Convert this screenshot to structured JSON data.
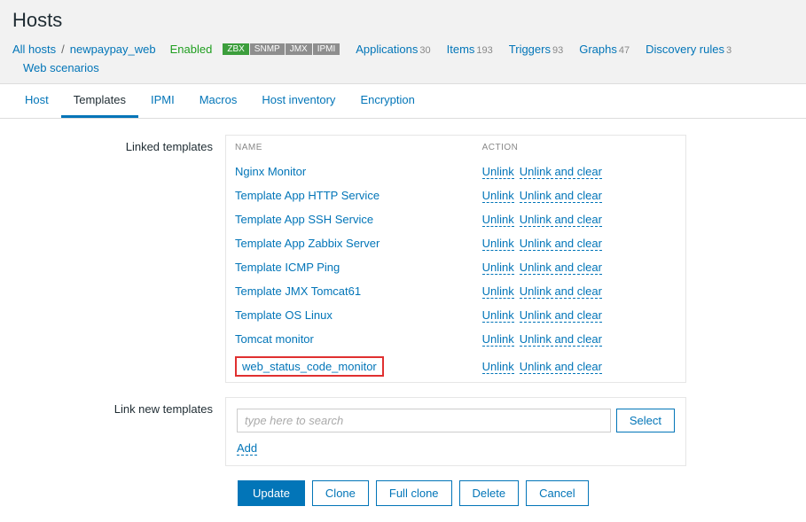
{
  "pageTitle": "Hosts",
  "breadcrumb": {
    "allHosts": "All hosts",
    "sep": "/",
    "hostName": "newpaypay_web",
    "enabled": "Enabled"
  },
  "proto": {
    "zbx": "ZBX",
    "snmp": "SNMP",
    "jmx": "JMX",
    "ipmi": "IPMI"
  },
  "stats": {
    "applications": {
      "label": "Applications",
      "count": "30"
    },
    "items": {
      "label": "Items",
      "count": "193"
    },
    "triggers": {
      "label": "Triggers",
      "count": "93"
    },
    "graphs": {
      "label": "Graphs",
      "count": "47"
    },
    "discovery": {
      "label": "Discovery rules",
      "count": "3"
    },
    "web": {
      "label": "Web scenarios"
    }
  },
  "tabs": {
    "host": "Host",
    "templates": "Templates",
    "ipmi": "IPMI",
    "macros": "Macros",
    "inventory": "Host inventory",
    "encryption": "Encryption"
  },
  "form": {
    "linkedLabel": "Linked templates",
    "linkNewLabel": "Link new templates",
    "headers": {
      "name": "NAME",
      "action": "ACTION"
    },
    "actions": {
      "unlink": "Unlink",
      "unlinkClear": "Unlink and clear"
    },
    "templates": {
      "t0": "Nginx Monitor",
      "t1": "Template App HTTP Service",
      "t2": "Template App SSH Service",
      "t3": "Template App Zabbix Server",
      "t4": "Template ICMP Ping",
      "t5": "Template JMX Tomcat61",
      "t6": "Template OS Linux",
      "t7": "Tomcat monitor",
      "t8": "web_status_code_monitor"
    },
    "search": {
      "placeholder": "type here to search",
      "selectBtn": "Select",
      "addLink": "Add"
    }
  },
  "buttons": {
    "update": "Update",
    "clone": "Clone",
    "fullClone": "Full clone",
    "delete": "Delete",
    "cancel": "Cancel"
  }
}
